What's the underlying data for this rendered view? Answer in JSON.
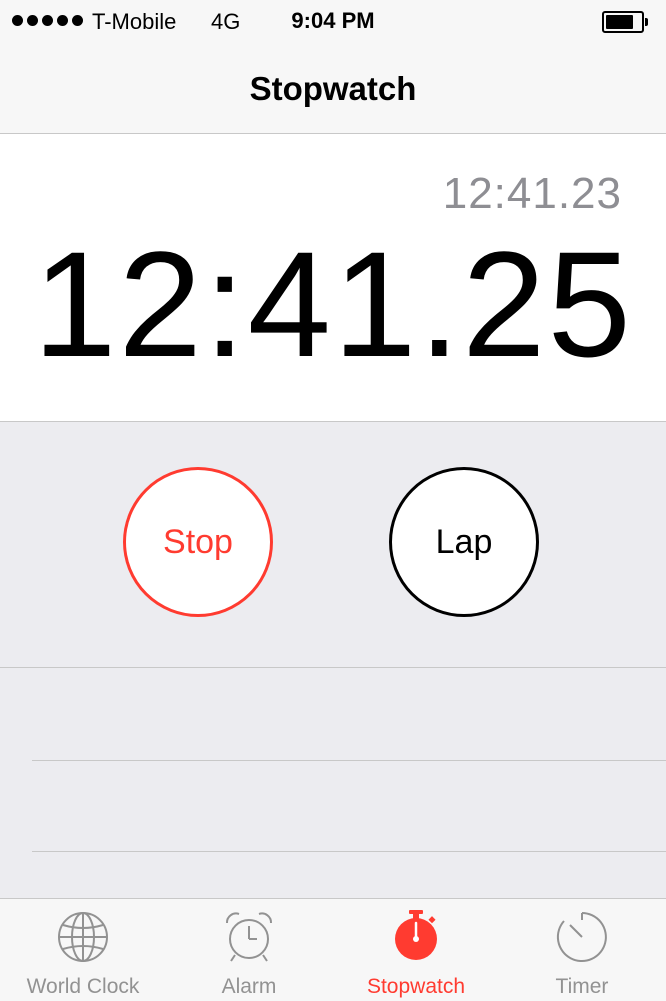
{
  "status_bar": {
    "carrier": "T-Mobile",
    "network": "4G",
    "time": "9:04 PM",
    "signal_bars": 5,
    "battery_icon": "battery-icon"
  },
  "nav": {
    "title": "Stopwatch"
  },
  "display": {
    "lap_time": "12:41.23",
    "main_time": "12:41.25"
  },
  "controls": {
    "stop_label": "Stop",
    "lap_label": "Lap"
  },
  "tabs": [
    {
      "label": "World Clock",
      "icon": "globe-icon",
      "active": false
    },
    {
      "label": "Alarm",
      "icon": "alarm-clock-icon",
      "active": false
    },
    {
      "label": "Stopwatch",
      "icon": "stopwatch-icon",
      "active": true
    },
    {
      "label": "Timer",
      "icon": "timer-icon",
      "active": false
    }
  ],
  "colors": {
    "accent": "#ff3b30",
    "inactive_tab": "#929292",
    "background_gray": "#ececf0"
  }
}
